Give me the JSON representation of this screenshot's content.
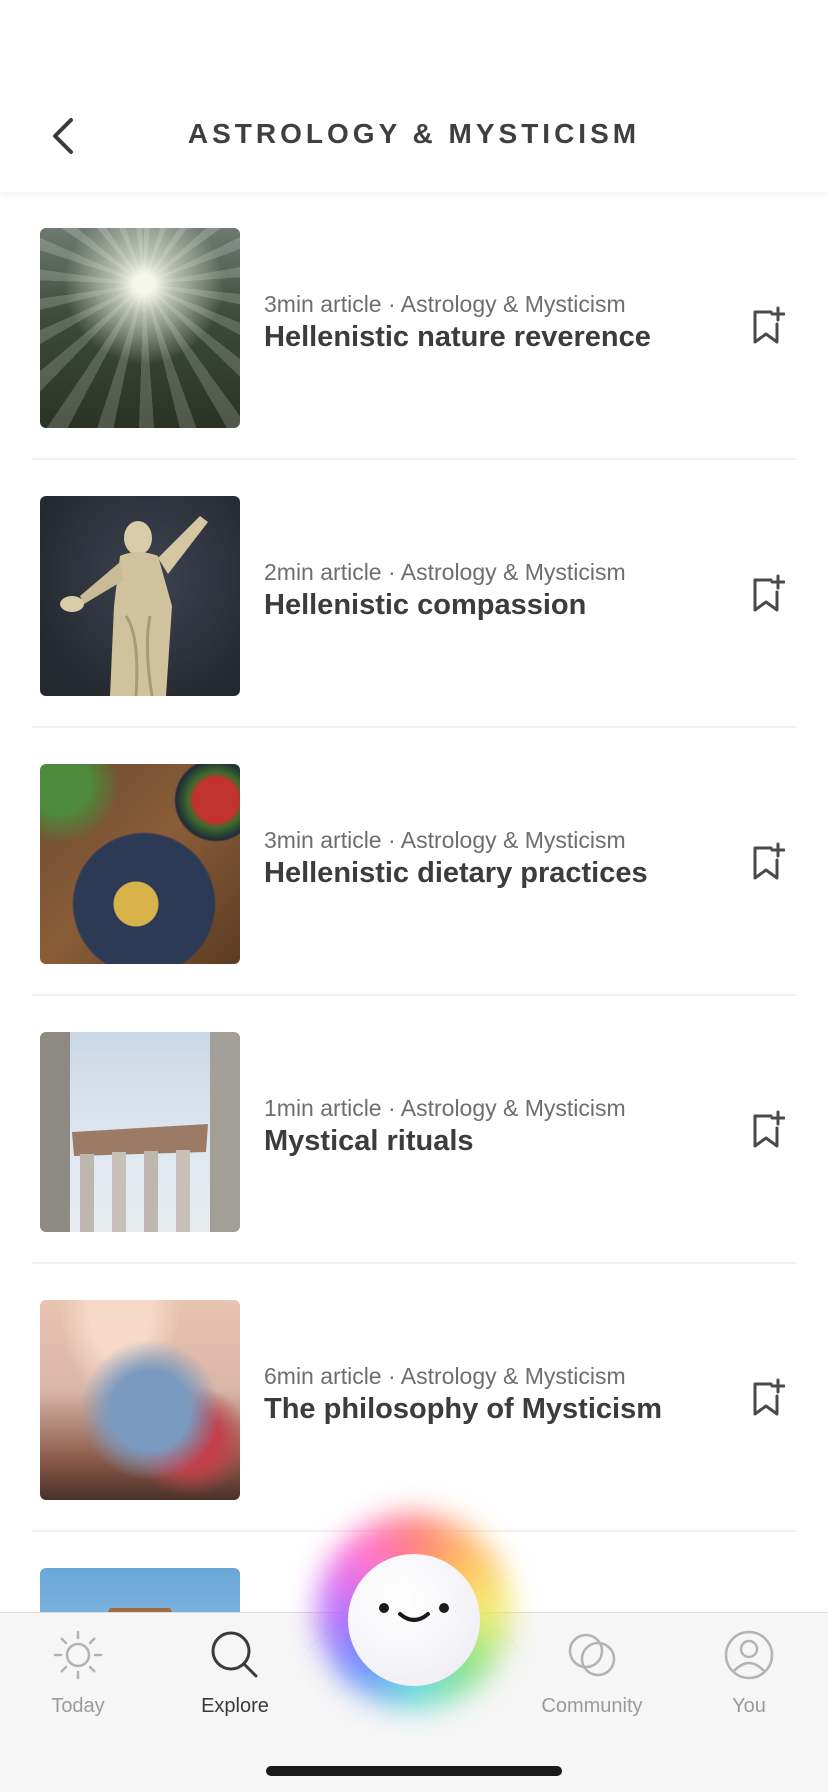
{
  "header": {
    "title": "ASTROLOGY & MYSTICISM"
  },
  "articles": [
    {
      "meta": "3min article · Astrology & Mysticism",
      "title": "Hellenistic nature reverence",
      "image": "sunlit-forest"
    },
    {
      "meta": "2min article · Astrology & Mysticism",
      "title": "Hellenistic compassion",
      "image": "marble-statue"
    },
    {
      "meta": "3min article · Astrology & Mysticism",
      "title": "Hellenistic dietary practices",
      "image": "food-bowls"
    },
    {
      "meta": "1min article · Astrology & Mysticism",
      "title": "Mystical rituals",
      "image": "greek-ruins"
    },
    {
      "meta": "6min article · Astrology & Mysticism",
      "title": "The philosophy of Mysticism",
      "image": "child-at-beach"
    },
    {
      "meta": "",
      "title": "",
      "image": "temple-sky"
    }
  ],
  "nav": {
    "items": [
      {
        "label": "Today",
        "icon": "sun-icon",
        "active": false
      },
      {
        "label": "Explore",
        "icon": "search-icon",
        "active": true
      },
      {
        "label": "Community",
        "icon": "community-icon",
        "active": false
      },
      {
        "label": "You",
        "icon": "profile-icon",
        "active": false
      }
    ],
    "center_icon": "smiley-face-icon"
  }
}
